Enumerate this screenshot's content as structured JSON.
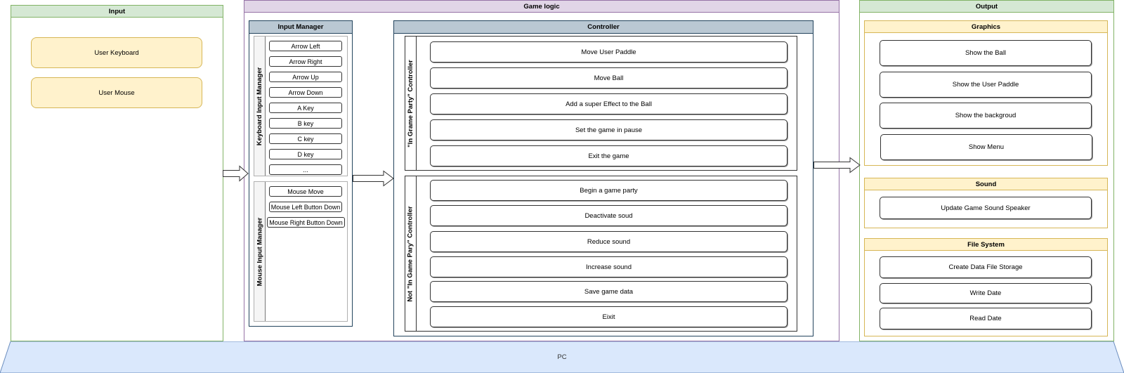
{
  "input": {
    "title": "Input",
    "items": [
      "User Keyboard",
      "User Mouse"
    ]
  },
  "game_logic": {
    "title": "Game logic",
    "input_manager": {
      "title": "Input Manager",
      "keyboard": {
        "title": "Keyboard Input Manager",
        "keys": [
          "Arrow Left",
          "Arrow Right",
          "Arrow Up",
          "Arrow Down",
          "A Key",
          "B key",
          "C key",
          "D key",
          "..."
        ]
      },
      "mouse": {
        "title": "Mouse Input Manager",
        "events": [
          "Mouse Move",
          "Mouse Left Button Down",
          "Mouse Right Button Down"
        ]
      }
    },
    "controller": {
      "title": "Controller",
      "in_game": {
        "title": "\"In Grame Party\" Controller",
        "actions": [
          "Move User Paddle",
          "Move Ball",
          "Add a super Effect to the Ball",
          "Set the game in pause",
          "Exit the game"
        ]
      },
      "not_in_game": {
        "title": "Not \"In Game Pary\" Controller",
        "actions": [
          "Begin a game party",
          "Deactivate soud",
          "Reduce sound",
          "Increase sound",
          "Save game data",
          "Eixit"
        ]
      }
    }
  },
  "output": {
    "title": "Output",
    "graphics": {
      "title": "Graphics",
      "items": [
        "Show the Ball",
        "Show the User Paddle",
        "Show the backgroud",
        "Show Menu"
      ]
    },
    "sound": {
      "title": "Sound",
      "items": [
        "Update Game Sound Speaker"
      ]
    },
    "file_system": {
      "title": "File System",
      "items": [
        "Create Data File Storage",
        "Write Date",
        "Read Date"
      ]
    }
  },
  "platform": {
    "label": "PC"
  },
  "colors": {
    "input_lane": "#d5e8d4",
    "game_logic_lane": "#e1d5e7",
    "manager_header": "#bac8d3",
    "output_group": "#fff2cc",
    "platform": "#dae8fc"
  }
}
